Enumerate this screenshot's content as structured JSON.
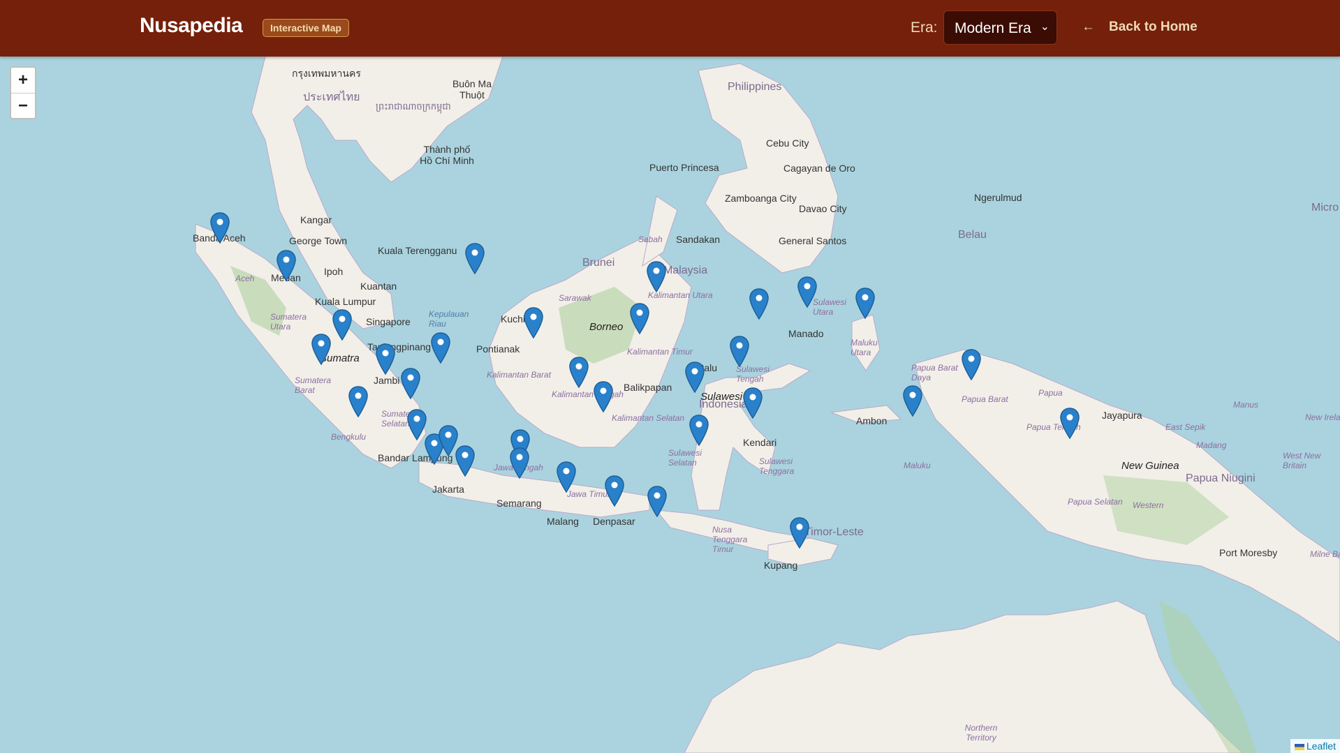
{
  "header": {
    "brand": "Nusapedia",
    "badge": "Interactive Map",
    "era_label": "Era:",
    "era_selected": "Modern Era",
    "back_label": "Back to Home"
  },
  "map": {
    "zoom_in": "+",
    "zoom_out": "−",
    "attribution": "Leaflet",
    "labels": [
      {
        "text": "Philippines",
        "kind": "country"
      },
      {
        "text": "Cebu City",
        "kind": "city"
      },
      {
        "text": "Cagayan de Oro",
        "kind": "city"
      },
      {
        "text": "Puerto Princesa",
        "kind": "city"
      },
      {
        "text": "Zamboanga City",
        "kind": "city"
      },
      {
        "text": "Davao City",
        "kind": "city"
      },
      {
        "text": "General Santos",
        "kind": "city"
      },
      {
        "text": "Ngerulmud",
        "kind": "city"
      },
      {
        "text": "Belau",
        "kind": "country"
      },
      {
        "text": "Sandakan",
        "kind": "city"
      },
      {
        "text": "Brunei",
        "kind": "country"
      },
      {
        "text": "Malaysia",
        "kind": "country"
      },
      {
        "text": "Sabah",
        "kind": "region"
      },
      {
        "text": "Sarawak",
        "kind": "region"
      },
      {
        "text": "Borneo",
        "kind": "big"
      },
      {
        "text": "Kuching",
        "kind": "city"
      },
      {
        "text": "Pontianak",
        "kind": "city"
      },
      {
        "text": "Balikpapan",
        "kind": "city"
      },
      {
        "text": "Kalimantan Utara",
        "kind": "region"
      },
      {
        "text": "Kalimantan Timur",
        "kind": "region"
      },
      {
        "text": "Kalimantan Barat",
        "kind": "region"
      },
      {
        "text": "Kalimantan Tengah",
        "kind": "region"
      },
      {
        "text": "Kalimantan Selatan",
        "kind": "region"
      },
      {
        "text": "Banda Aceh",
        "kind": "city"
      },
      {
        "text": "Aceh",
        "kind": "region"
      },
      {
        "text": "Medan",
        "kind": "city"
      },
      {
        "text": "George Town",
        "kind": "city"
      },
      {
        "text": "Kangar",
        "kind": "city"
      },
      {
        "text": "Ipoh",
        "kind": "city"
      },
      {
        "text": "Kuala Terengganu",
        "kind": "city"
      },
      {
        "text": "Kuantan",
        "kind": "city"
      },
      {
        "text": "Kuala Lumpur",
        "kind": "city"
      },
      {
        "text": "Singapore",
        "kind": "city"
      },
      {
        "text": "Tanjungpinang",
        "kind": "city"
      },
      {
        "text": "Kepulauan Riau",
        "kind": "region"
      },
      {
        "text": "Sumatera Utara",
        "kind": "region"
      },
      {
        "text": "Sumatra",
        "kind": "big"
      },
      {
        "text": "Sumatera Barat",
        "kind": "region"
      },
      {
        "text": "Jambi",
        "kind": "city"
      },
      {
        "text": "Sumatera Selatan",
        "kind": "region"
      },
      {
        "text": "Bengkulu",
        "kind": "region"
      },
      {
        "text": "Bandar Lampung",
        "kind": "city"
      },
      {
        "text": "Jakarta",
        "kind": "city"
      },
      {
        "text": "Semarang",
        "kind": "city"
      },
      {
        "text": "Jawa Tengah",
        "kind": "region"
      },
      {
        "text": "Jawa Timur",
        "kind": "region"
      },
      {
        "text": "Malang",
        "kind": "city"
      },
      {
        "text": "Denpasar",
        "kind": "city"
      },
      {
        "text": "Nusa Tenggara Timur",
        "kind": "region"
      },
      {
        "text": "Kupang",
        "kind": "city"
      },
      {
        "text": "Timor-Leste",
        "kind": "country"
      },
      {
        "text": "Palu",
        "kind": "city"
      },
      {
        "text": "Sulawesi",
        "kind": "big"
      },
      {
        "text": "Indonesia",
        "kind": "country"
      },
      {
        "text": "Sulawesi Tengah",
        "kind": "region"
      },
      {
        "text": "Sulawesi Selatan",
        "kind": "region"
      },
      {
        "text": "Sulawesi Tenggara",
        "kind": "region"
      },
      {
        "text": "Kendari",
        "kind": "city"
      },
      {
        "text": "Manado",
        "kind": "city"
      },
      {
        "text": "Sulawesi Utara",
        "kind": "region"
      },
      {
        "text": "Maluku Utara",
        "kind": "region"
      },
      {
        "text": "Ambon",
        "kind": "city"
      },
      {
        "text": "Maluku",
        "kind": "region"
      },
      {
        "text": "Papua Barat Daya",
        "kind": "region"
      },
      {
        "text": "Papua Barat",
        "kind": "region"
      },
      {
        "text": "Papua",
        "kind": "region"
      },
      {
        "text": "Papua Tengah",
        "kind": "region"
      },
      {
        "text": "Papua Selatan",
        "kind": "region"
      },
      {
        "text": "Jayapura",
        "kind": "city"
      },
      {
        "text": "New Guinea",
        "kind": "big"
      },
      {
        "text": "Papua Niugini",
        "kind": "country"
      },
      {
        "text": "East Sepik",
        "kind": "region"
      },
      {
        "text": "Madang",
        "kind": "region"
      },
      {
        "text": "Manus",
        "kind": "region"
      },
      {
        "text": "New Ireland",
        "kind": "region"
      },
      {
        "text": "West New Britain",
        "kind": "region"
      },
      {
        "text": "Western",
        "kind": "region"
      },
      {
        "text": "Port Moresby",
        "kind": "city"
      },
      {
        "text": "Milne Bay",
        "kind": "region"
      },
      {
        "text": "Micro",
        "kind": "country"
      },
      {
        "text": "Northern Territory",
        "kind": "region"
      },
      {
        "text": "Buôn Ma Thuột",
        "kind": "city"
      },
      {
        "text": "Thành phố Hồ Chí Minh",
        "kind": "city"
      },
      {
        "text": "กรุงเทพมหานคร",
        "kind": "city"
      },
      {
        "text": "ประเทศไทย",
        "kind": "country"
      },
      {
        "text": "ព្រះរាជាណាចក្រកម្ពុជា",
        "kind": "country"
      }
    ],
    "marker_count": 33
  }
}
